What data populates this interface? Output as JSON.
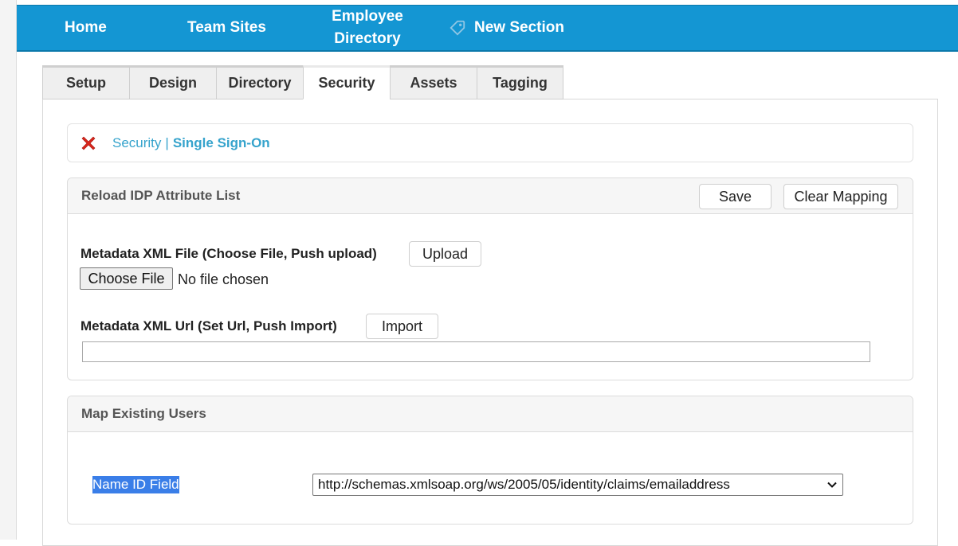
{
  "nav": {
    "items": [
      {
        "label": "Home"
      },
      {
        "label": "Team Sites"
      },
      {
        "label": "Employee Directory"
      },
      {
        "label": "New Section",
        "icon": "tag-icon"
      }
    ]
  },
  "tabs": [
    {
      "label": "Setup",
      "active": false
    },
    {
      "label": "Design",
      "active": false
    },
    {
      "label": "Directory",
      "active": false
    },
    {
      "label": "Security",
      "active": true
    },
    {
      "label": "Assets",
      "active": false
    },
    {
      "label": "Tagging",
      "active": false
    }
  ],
  "breadcrumb": {
    "parent": "Security",
    "separator": "|",
    "current": "Single Sign-On",
    "close_icon": "close-x-icon"
  },
  "reload_card": {
    "title": "Reload IDP Attribute List",
    "save_label": "Save",
    "clear_label": "Clear Mapping",
    "metadata_file_label": "Metadata XML File (Choose File, Push upload)",
    "upload_label": "Upload",
    "choose_file_label": "Choose File",
    "file_status": "No file chosen",
    "metadata_url_label": "Metadata XML Url (Set Url, Push Import)",
    "import_label": "Import",
    "url_value": ""
  },
  "map_card": {
    "title": "Map Existing Users",
    "name_id_label": "Name ID Field",
    "name_id_value": "http://schemas.xmlsoap.org/ws/2005/05/identity/claims/emailaddress"
  },
  "colors": {
    "nav_bg": "#1496d3",
    "link": "#35a3cc",
    "selection": "#3a7ee8",
    "close_icon": "#d9261c"
  }
}
